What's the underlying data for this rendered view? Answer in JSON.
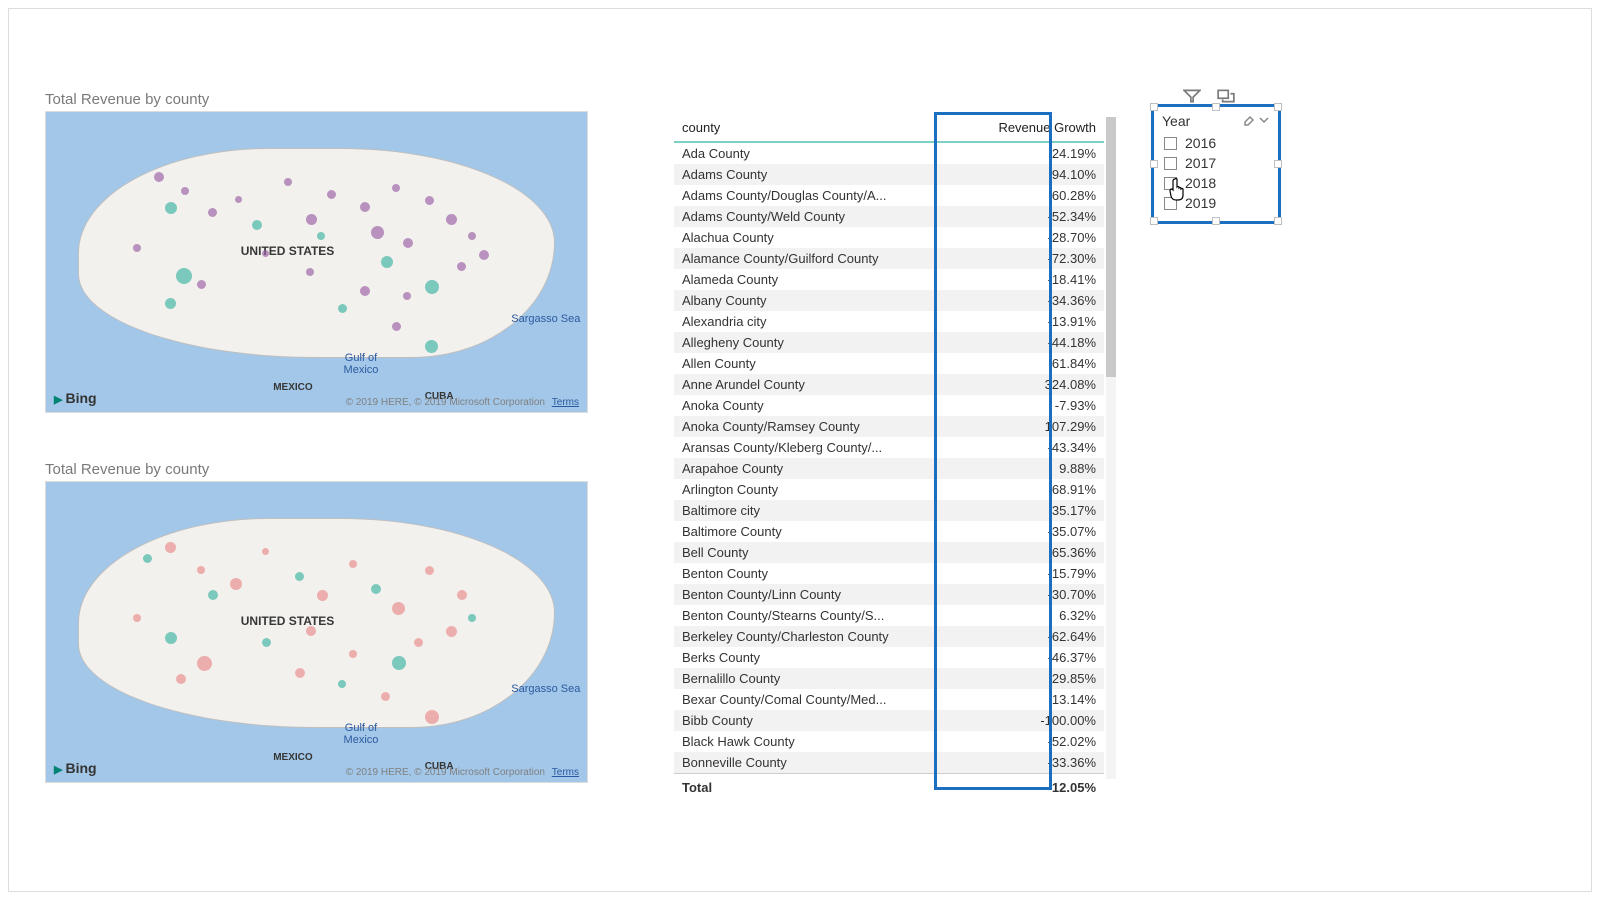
{
  "map1": {
    "title": "Total Revenue by county",
    "country_label": "UNITED STATES",
    "mexico_label": "MEXICO",
    "cuba_label": "CUBA",
    "sea_label": "Sargasso Sea",
    "gulf_label_1": "Gulf of",
    "gulf_label_2": "Mexico",
    "logo": "Bing",
    "attrib": "© 2019 HERE, © 2019 Microsoft Corporation",
    "terms": "Terms"
  },
  "map2": {
    "title": "Total Revenue by county",
    "country_label": "UNITED STATES",
    "mexico_label": "MEXICO",
    "cuba_label": "CUBA",
    "sea_label": "Sargasso Sea",
    "gulf_label_1": "Gulf of",
    "gulf_label_2": "Mexico",
    "logo": "Bing",
    "attrib": "© 2019 HERE, © 2019 Microsoft Corporation",
    "terms": "Terms"
  },
  "table": {
    "col_county": "county",
    "col_growth": "Revenue Growth",
    "total_label": "Total",
    "total_value": "-12.05%",
    "rows": [
      {
        "c": "Ada County",
        "g": "24.19%"
      },
      {
        "c": "Adams County",
        "g": "94.10%"
      },
      {
        "c": "Adams County/Douglas County/A...",
        "g": "60.28%"
      },
      {
        "c": "Adams County/Weld County",
        "g": "-52.34%"
      },
      {
        "c": "Alachua County",
        "g": "-28.70%"
      },
      {
        "c": "Alamance County/Guilford County",
        "g": "-72.30%"
      },
      {
        "c": "Alameda County",
        "g": "-18.41%"
      },
      {
        "c": "Albany County",
        "g": "-34.36%"
      },
      {
        "c": "Alexandria city",
        "g": "-13.91%"
      },
      {
        "c": "Allegheny County",
        "g": "-44.18%"
      },
      {
        "c": "Allen County",
        "g": "61.84%"
      },
      {
        "c": "Anne Arundel County",
        "g": "324.08%"
      },
      {
        "c": "Anoka County",
        "g": "-7.93%"
      },
      {
        "c": "Anoka County/Ramsey County",
        "g": "107.29%"
      },
      {
        "c": "Aransas County/Kleberg County/...",
        "g": "-43.34%"
      },
      {
        "c": "Arapahoe County",
        "g": "9.88%"
      },
      {
        "c": "Arlington County",
        "g": "68.91%"
      },
      {
        "c": "Baltimore city",
        "g": "35.17%"
      },
      {
        "c": "Baltimore County",
        "g": "-35.07%"
      },
      {
        "c": "Bell County",
        "g": "65.36%"
      },
      {
        "c": "Benton County",
        "g": "-15.79%"
      },
      {
        "c": "Benton County/Linn County",
        "g": "-30.70%"
      },
      {
        "c": "Benton County/Stearns County/S...",
        "g": "6.32%"
      },
      {
        "c": "Berkeley County/Charleston County",
        "g": "-62.64%"
      },
      {
        "c": "Berks County",
        "g": "-46.37%"
      },
      {
        "c": "Bernalillo County",
        "g": "29.85%"
      },
      {
        "c": "Bexar County/Comal County/Med...",
        "g": "13.14%"
      },
      {
        "c": "Bibb County",
        "g": "-100.00%"
      },
      {
        "c": "Black Hawk County",
        "g": "-52.02%"
      },
      {
        "c": "Bonneville County",
        "g": "-33.36%"
      }
    ]
  },
  "slicer": {
    "title": "Year",
    "items": [
      "2016",
      "2017",
      "2018",
      "2019"
    ]
  }
}
